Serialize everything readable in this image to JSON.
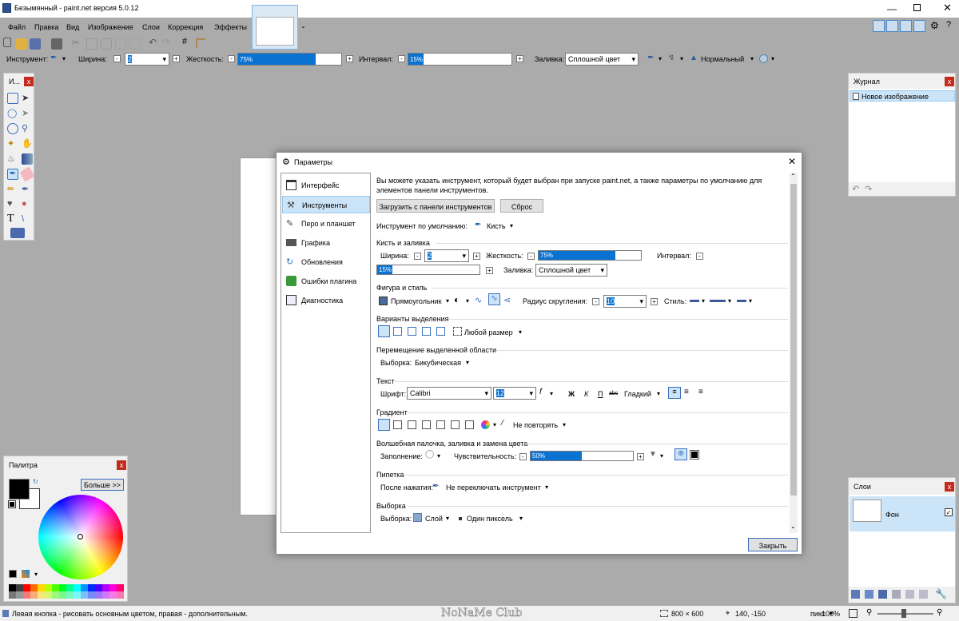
{
  "app": {
    "title": "Безымянный - paint.net версия 5.0.12"
  },
  "menu": [
    "Файл",
    "Правка",
    "Вид",
    "Изображение",
    "Слои",
    "Коррекция",
    "Эффекты"
  ],
  "toolbar": {
    "tool_label": "Инструмент:",
    "width_label": "Ширина:",
    "width_value": "2",
    "hardness_label": "Жесткость:",
    "hardness_value": "75%",
    "hardness_fraction": 0.75,
    "interval_label": "Интервал:",
    "interval_value": "15%",
    "interval_fraction": 0.15,
    "fill_label": "Заливка:",
    "fill_value": "Сплошной цвет",
    "blend_value": "Нормальный"
  },
  "tools_panel": {
    "title": "И..."
  },
  "history": {
    "title": "Журнал",
    "items": [
      "Новое изображение"
    ]
  },
  "palette": {
    "title": "Палитра",
    "more_button": "Больше >>",
    "colors": [
      "#000000",
      "#404040",
      "#ff0000",
      "#ff6a00",
      "#ffd800",
      "#b6ff00",
      "#4cff00",
      "#00ff21",
      "#00ff90",
      "#00ffff",
      "#0094ff",
      "#0026ff",
      "#4800ff",
      "#b200ff",
      "#ff00dc",
      "#ff006e"
    ]
  },
  "layers": {
    "title": "Слои",
    "items": [
      {
        "name": "Фон",
        "visible": true
      }
    ]
  },
  "dialog": {
    "title": "Параметры",
    "nav": [
      {
        "label": "Интерфейс"
      },
      {
        "label": "Инструменты"
      },
      {
        "label": "Перо и планшет"
      },
      {
        "label": "Графика"
      },
      {
        "label": "Обновления"
      },
      {
        "label": "Ошибки плагина"
      },
      {
        "label": "Диагностика"
      }
    ],
    "description": "Вы можете указать инструмент, который будет выбран при запуске paint.net, а также параметры по умолчанию для элементов панели инструментов.",
    "load_button": "Загрузить с панели инструментов",
    "reset_button": "Сброс",
    "default_tool_label": "Инструмент по умолчанию:",
    "default_tool_value": "Кисть",
    "brush_section": "Кисть и заливка",
    "width_label": "Ширина:",
    "width_value": "2",
    "hardness_label": "Жесткость:",
    "hardness_value": "75%",
    "hardness_fraction": 0.75,
    "interval_label": "Интервал:",
    "interval_value": "15%",
    "interval_fraction": 0.15,
    "fill_label": "Заливка:",
    "fill_value": "Сплошной цвет",
    "shape_section": "Фигура и стиль",
    "shape_value": "Прямоугольник",
    "radius_label": "Радиус скругления:",
    "radius_value": "10",
    "style_label": "Стиль:",
    "selection_section": "Варианты выделения",
    "size_value": "Любой размер",
    "move_section": "Перемещение выделенной области",
    "sampling_label": "Выборка:",
    "sampling_value": "Бикубическая",
    "text_section": "Текст",
    "font_label": "Шрифт:",
    "font_value": "Calibri",
    "font_size": "12",
    "bold": "Ж",
    "italic": "К",
    "underline": "П",
    "strike": "abc",
    "smooth_value": "Гладкий",
    "gradient_section": "Градиент",
    "repeat_value": "Не повторять",
    "wand_section": "Волшебная палочка, заливка и замена цвета",
    "flood_label": "Заполнение:",
    "sensitivity_label": "Чувствительность:",
    "sensitivity_value": "50%",
    "sensitivity_fraction": 0.5,
    "picker_section": "Пипетка",
    "after_click_label": "После нажатия:",
    "after_click_value": "Не переключать инструмент",
    "sample_section": "Выборка",
    "sample_label": "Выборка:",
    "sample_value": "Слой",
    "sample_size": "Один пиксель",
    "close_button": "Закрыть"
  },
  "status": {
    "hint": "Левая кнопка - рисовать основным цветом, правая - дополнительным.",
    "size": "800 × 600",
    "coords": "140, -150",
    "unit": "пикс",
    "zoom": "100%",
    "watermark": "NoNaMe Club"
  }
}
